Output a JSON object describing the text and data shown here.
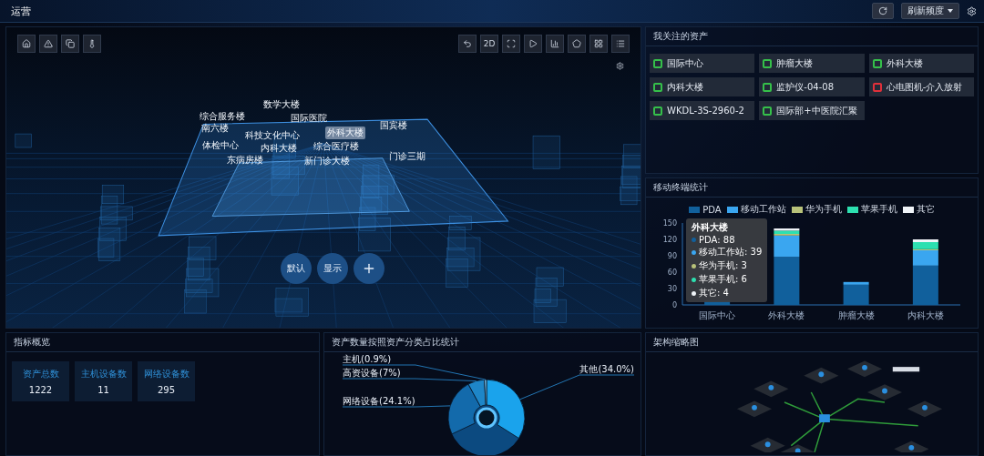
{
  "top_bar": {
    "title": "运营",
    "refresh_rate": "刷新频度"
  },
  "scene": {
    "view_mode_button": "2D",
    "building_labels": [
      {
        "label": "数学大楼",
        "selected": false
      },
      {
        "label": "综合服务楼",
        "selected": false
      },
      {
        "label": "南六楼",
        "selected": false
      },
      {
        "label": "国际医院",
        "selected": false
      },
      {
        "label": "外科大楼",
        "selected": true
      },
      {
        "label": "国宾楼",
        "selected": false
      },
      {
        "label": "科技文化中心",
        "selected": false
      },
      {
        "label": "体检中心",
        "selected": false
      },
      {
        "label": "内科大楼",
        "selected": false
      },
      {
        "label": "综合医疗楼",
        "selected": false
      },
      {
        "label": "东病房楼",
        "selected": false
      },
      {
        "label": "新门诊大楼",
        "selected": false
      },
      {
        "label": "门诊三期",
        "selected": false
      }
    ],
    "buttons": [
      "默认",
      "显示"
    ]
  },
  "watched_assets": {
    "title": "我关注的资产",
    "items": [
      {
        "name": "国际中心",
        "color": "#35c04a"
      },
      {
        "name": "肿瘤大楼",
        "color": "#35c04a"
      },
      {
        "name": "外科大楼",
        "color": "#35c04a"
      },
      {
        "name": "内科大楼",
        "color": "#35c04a"
      },
      {
        "name": "监护仪-04-08",
        "color": "#35c04a"
      },
      {
        "name": "心电图机-介入放射",
        "color": "#e0303a"
      },
      {
        "name": "WKDL-3S-2960-2",
        "color": "#35c04a"
      },
      {
        "name": "国际部+中医院汇聚",
        "color": "#35c04a"
      }
    ]
  },
  "mobile_terminals": {
    "title": "移动终端统计",
    "chart_data": {
      "type": "bar",
      "stacked": true,
      "categories": [
        "国际中心",
        "外科大楼",
        "肿瘤大楼",
        "内科大楼"
      ],
      "ylim": [
        0,
        150
      ],
      "yticks": [
        0,
        30,
        60,
        90,
        120,
        150
      ],
      "series": [
        {
          "name": "PDA",
          "color": "#11609c",
          "values": [
            8,
            88,
            37,
            72
          ]
        },
        {
          "name": "移动工作站",
          "color": "#3aa6f0",
          "values": [
            0,
            39,
            5,
            28
          ]
        },
        {
          "name": "华为手机",
          "color": "#b8c27a",
          "values": [
            0,
            3,
            0,
            2
          ]
        },
        {
          "name": "苹果手机",
          "color": "#2de0b0",
          "values": [
            0,
            6,
            0,
            13
          ]
        },
        {
          "name": "其它",
          "color": "#f0f4f8",
          "values": [
            0,
            4,
            0,
            5
          ]
        }
      ]
    },
    "tooltip": {
      "title": "外科大楼",
      "rows": [
        {
          "label": "PDA: 88",
          "color": "#11609c"
        },
        {
          "label": "移动工作站: 39",
          "color": "#3aa6f0"
        },
        {
          "label": "华为手机: 3",
          "color": "#b8c27a"
        },
        {
          "label": "苹果手机: 6",
          "color": "#2de0b0"
        },
        {
          "label": "其它: 4",
          "color": "#f0f4f8"
        }
      ]
    }
  },
  "overview": {
    "title": "指标概览",
    "stats": [
      {
        "label": "资产总数",
        "value": "1222"
      },
      {
        "label": "主机设备数",
        "value": "11"
      },
      {
        "label": "网络设备数",
        "value": "295"
      }
    ]
  },
  "asset_share": {
    "title": "资产数量按照资产分类占比统计",
    "chart_data": {
      "type": "donut",
      "values": [
        34.0,
        24.1,
        7,
        0.9
      ],
      "value_labels": [
        "其他(34.0%)",
        "网络设备(24.1%)",
        "高资设备(7%)",
        "主机(0.9%)"
      ]
    }
  },
  "topology": {
    "title": "架构缩略图"
  }
}
